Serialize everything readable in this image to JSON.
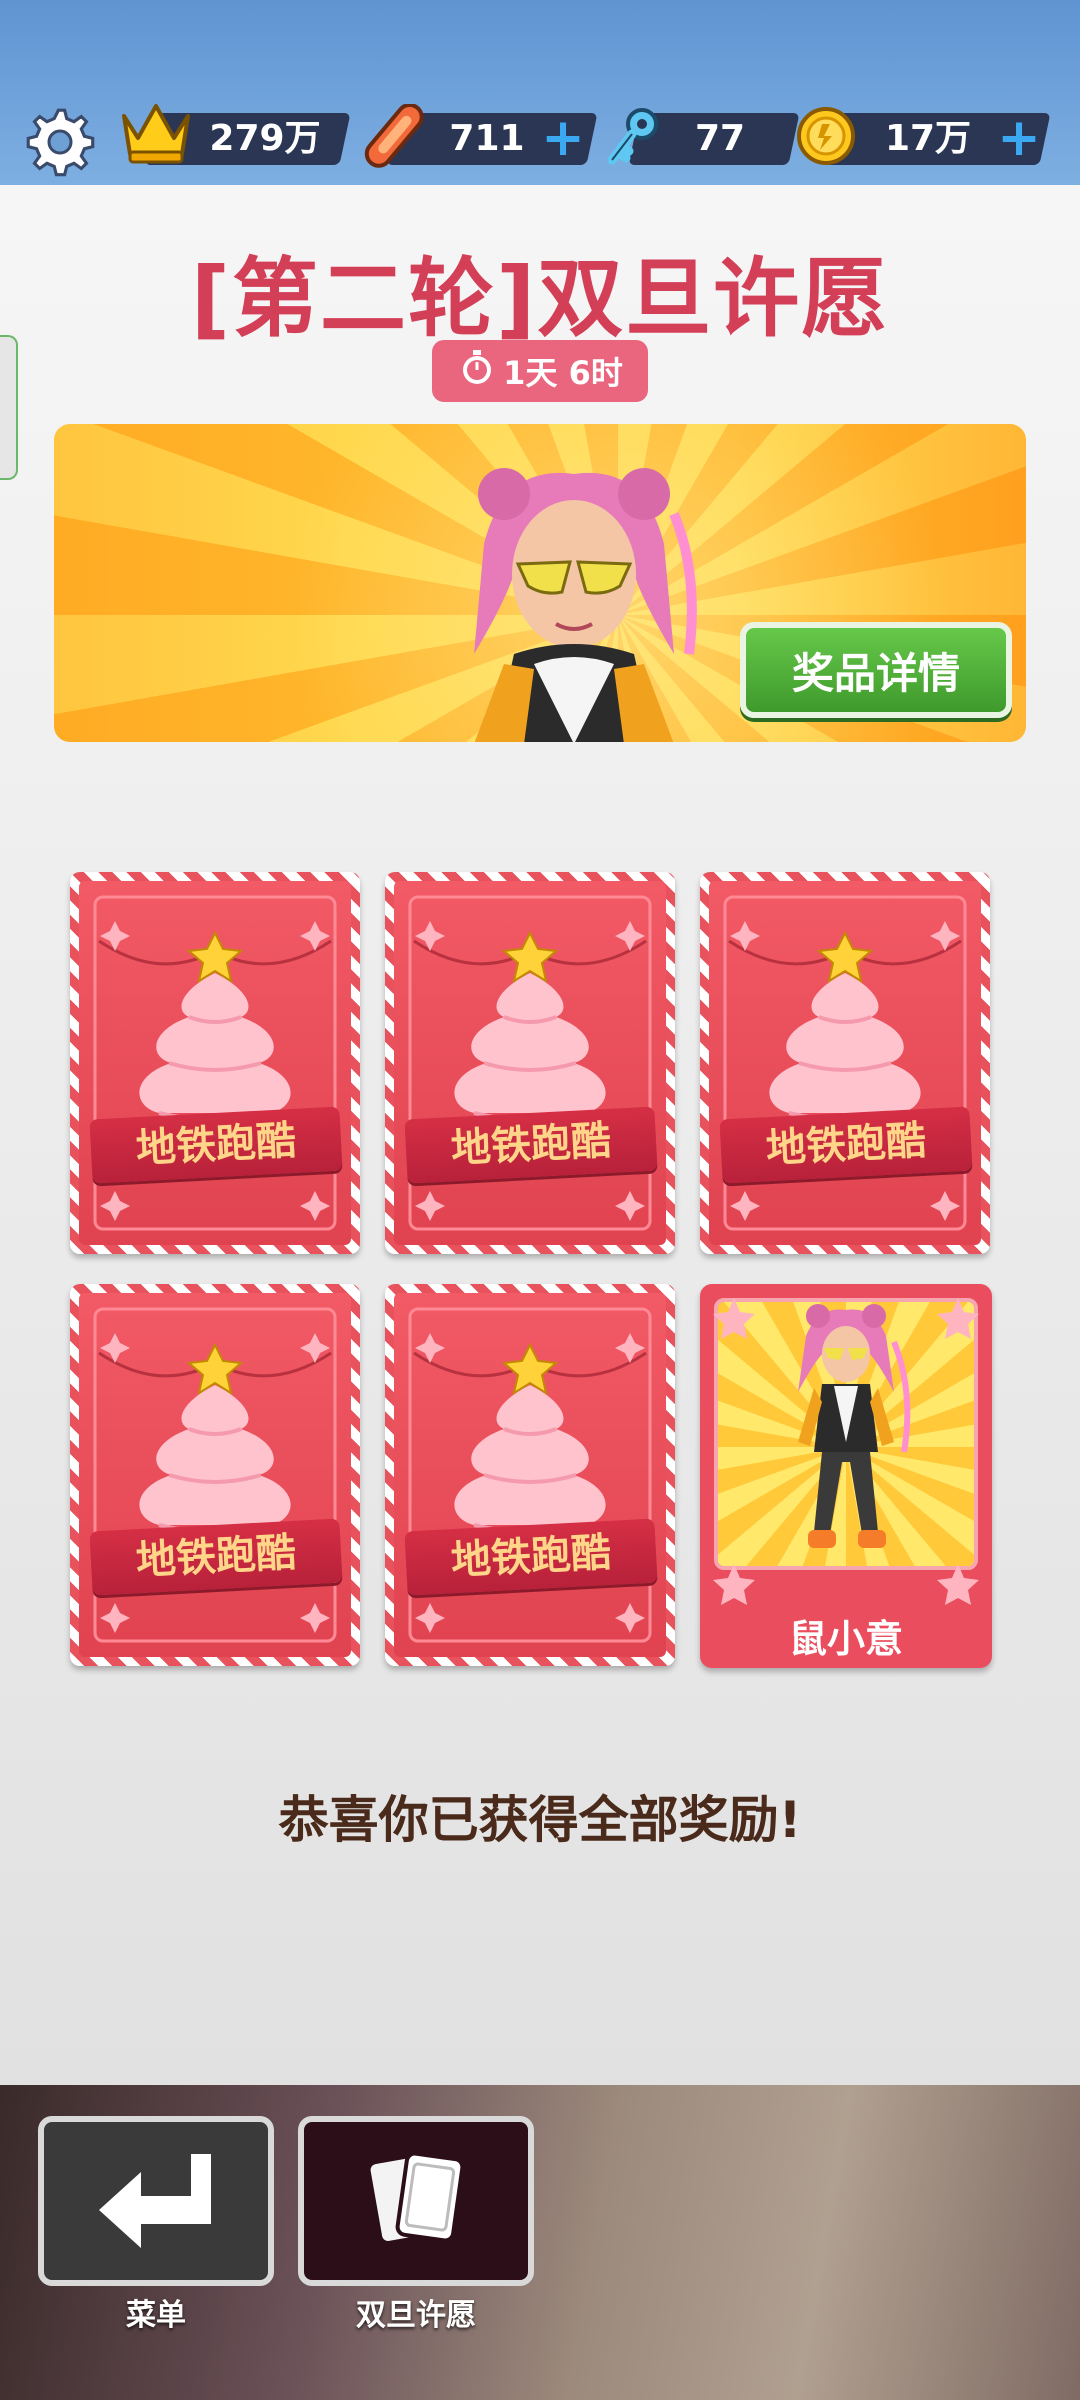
{
  "topbar": {
    "crown_value": "279万",
    "hoverboard_value": "711",
    "key_value": "77",
    "coin_value": "17万",
    "plus_label": "+"
  },
  "event": {
    "title": "[第二轮]双旦许愿",
    "timer": "1天 6时",
    "prize_button": "奖品详情"
  },
  "cards": [
    {
      "label": "地铁跑酷"
    },
    {
      "label": "地铁跑酷"
    },
    {
      "label": "地铁跑酷"
    },
    {
      "label": "地铁跑酷"
    },
    {
      "label": "地铁跑酷"
    }
  ],
  "revealed_card": {
    "name": "鼠小意"
  },
  "message": "恭喜你已获得全部奖励!",
  "bottom_nav": {
    "menu_label": "菜单",
    "wish_label": "双旦许愿"
  },
  "colors": {
    "title": "#d33f57",
    "timer_bg": "#e9667e",
    "card_red": "#e8525c",
    "prize_button": "#4fae38",
    "plus": "#3aa9f2"
  }
}
